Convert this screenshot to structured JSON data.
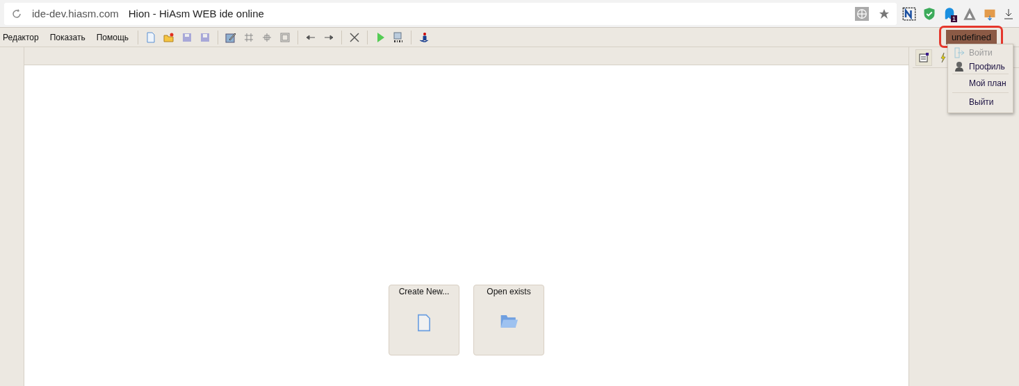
{
  "browser": {
    "url": "ide-dev.hiasm.com",
    "title": "Hion - HiAsm WEB ide online",
    "extension_badge": "1"
  },
  "menu_bar": [
    "Редактор",
    "Показать",
    "Помощь"
  ],
  "user_button": {
    "label": "undefined",
    "highlighted": true
  },
  "user_menu": [
    {
      "label": "Войти",
      "disabled": true,
      "kind": "login"
    },
    {
      "label": "Профиль",
      "disabled": false,
      "kind": "profile"
    },
    {
      "label": "Мой план",
      "disabled": false,
      "kind": "plain"
    },
    {
      "label": "Выйти",
      "disabled": false,
      "kind": "plain"
    }
  ],
  "start_buttons": [
    {
      "label": "Create New...",
      "kind": "new"
    },
    {
      "label": "Open exists",
      "kind": "open"
    }
  ]
}
